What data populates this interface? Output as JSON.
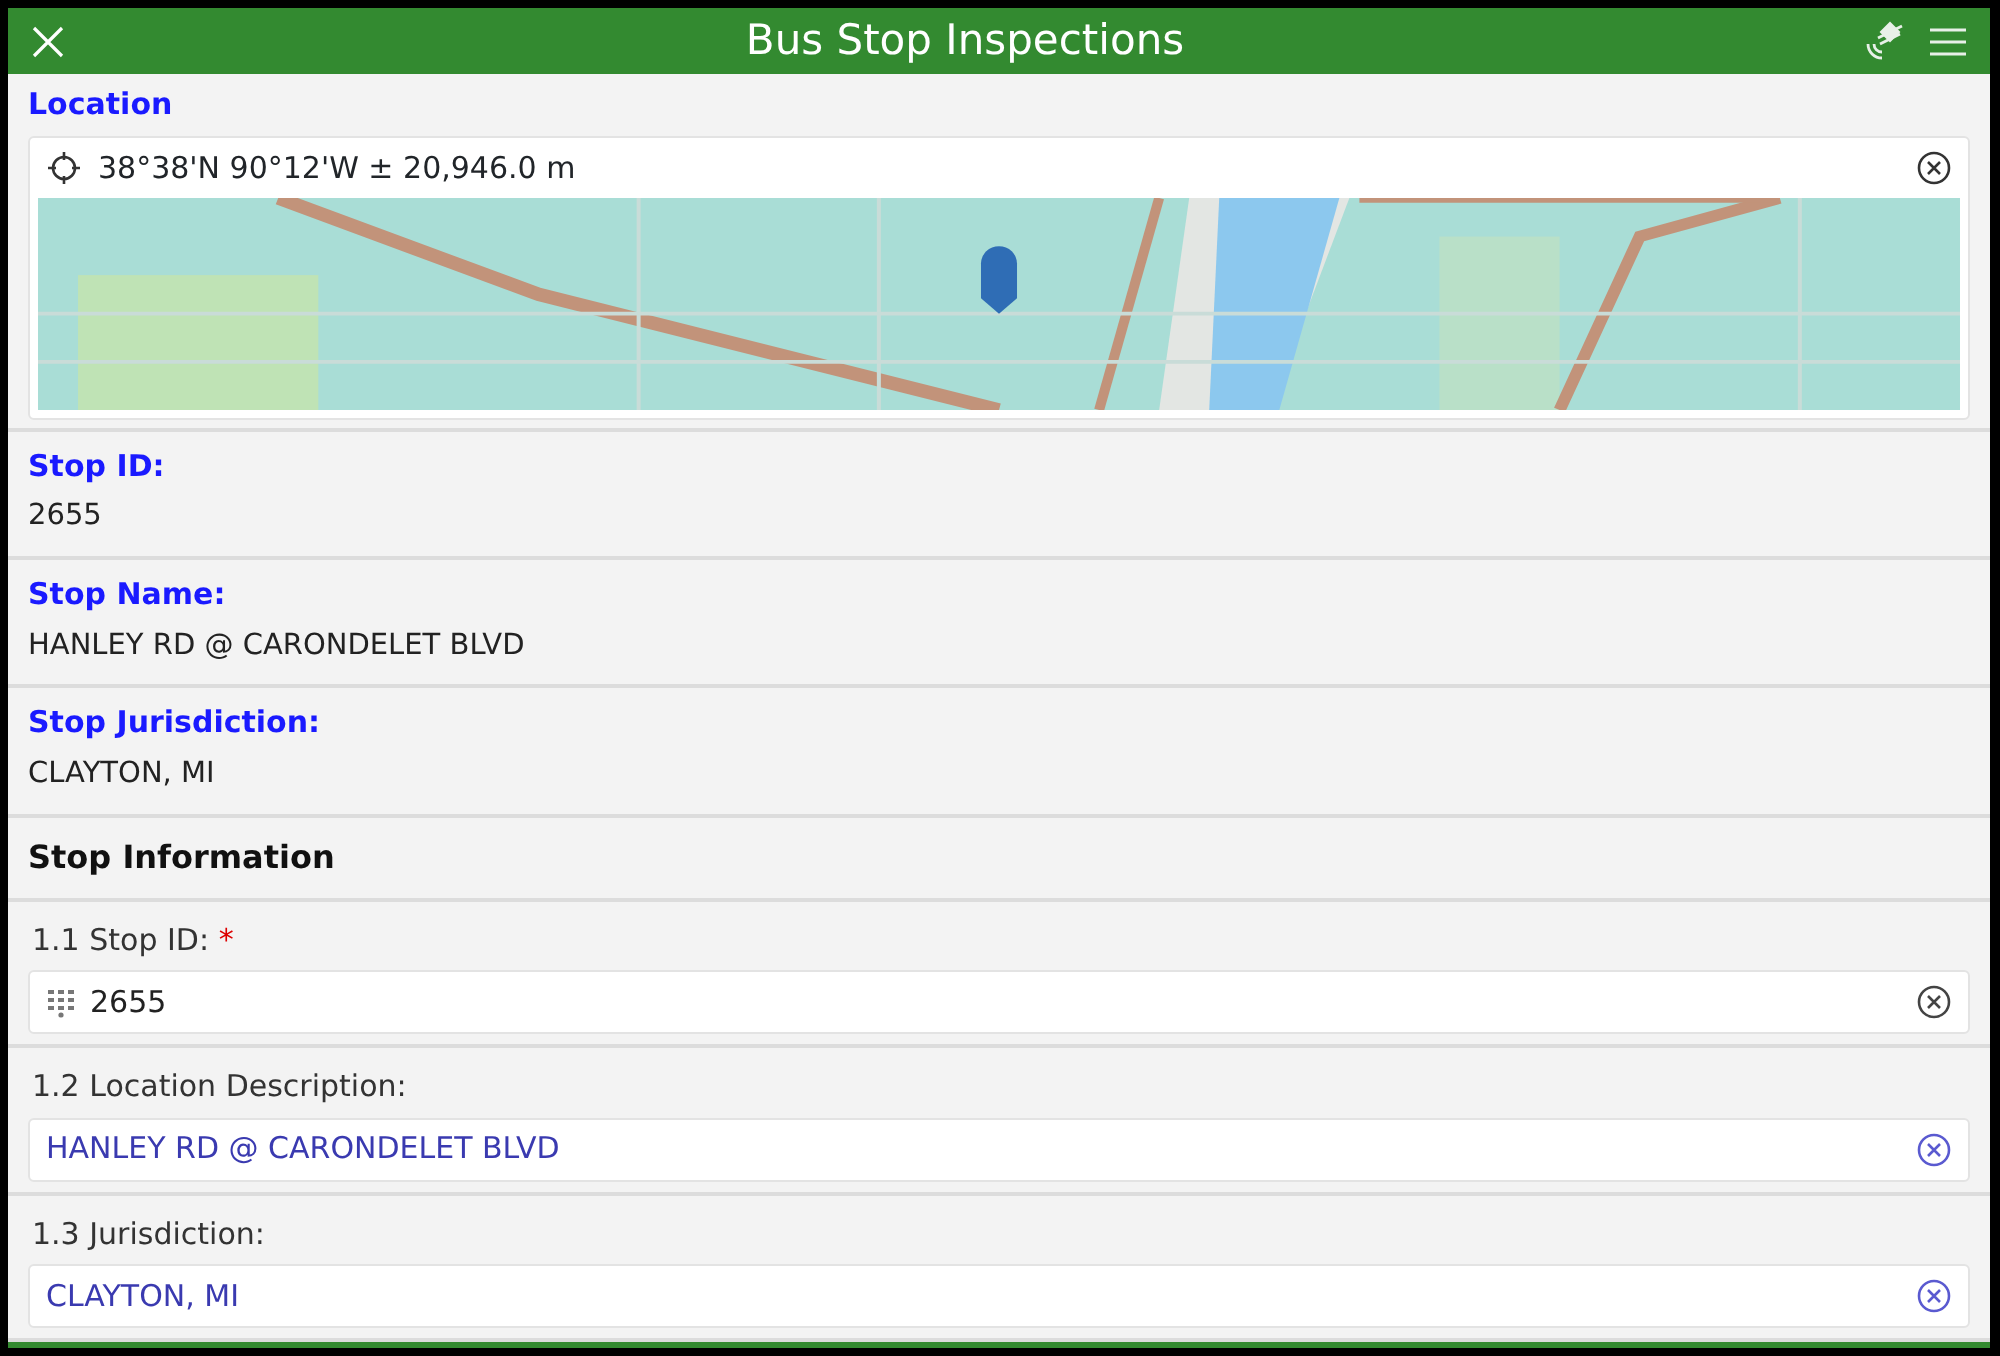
{
  "header": {
    "title": "Bus Stop Inspections"
  },
  "location": {
    "label": "Location",
    "value": "38°38'N 90°12'W ± 20,946.0 m"
  },
  "info_fields": [
    {
      "label": "Stop ID:",
      "value": "2655"
    },
    {
      "label": "Stop Name:",
      "value": "HANLEY RD @ CARONDELET BLVD"
    },
    {
      "label": "Stop Jurisdiction:",
      "value": "CLAYTON, MI"
    }
  ],
  "section": {
    "title": "Stop Information"
  },
  "form_fields": [
    {
      "label": "1.1 Stop ID:",
      "required_mark": "*",
      "kind": "numeric",
      "value": "2655"
    },
    {
      "label": "1.2 Location Description:",
      "kind": "text",
      "value": "HANLEY RD @ CARONDELET BLVD"
    },
    {
      "label": "1.3 Jurisdiction:",
      "kind": "text",
      "value": "CLAYTON, MI"
    }
  ]
}
